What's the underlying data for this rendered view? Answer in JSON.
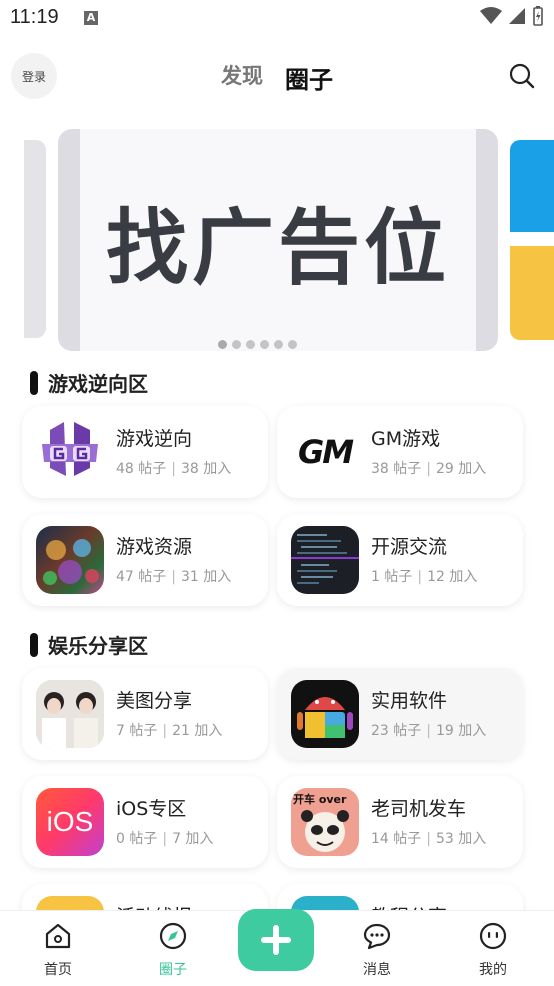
{
  "status_bar": {
    "time": "11:19",
    "notif_letter": "A"
  },
  "header": {
    "login_label": "登录",
    "tabs": [
      {
        "label": "发现",
        "active": false
      },
      {
        "label": "圈子",
        "active": true
      }
    ]
  },
  "banner": {
    "text": "找广告位",
    "dot_count": 6,
    "active_dot": 0
  },
  "sections": [
    {
      "title": "游戏逆向区",
      "cards": [
        {
          "title": "游戏逆向",
          "posts": "48 帖子",
          "joins": "38 加入",
          "icon": "game-guardian-icon"
        },
        {
          "title": "GM游戏",
          "posts": "38 帖子",
          "joins": "29 加入",
          "icon": "gm-logo-icon",
          "icon_text": "GM"
        },
        {
          "title": "游戏资源",
          "posts": "47 帖子",
          "joins": "31 加入",
          "icon": "game-art-icon"
        },
        {
          "title": "开源交流",
          "posts": "1 帖子",
          "joins": "12 加入",
          "icon": "code-terminal-icon"
        }
      ]
    },
    {
      "title": "娱乐分享区",
      "cards": [
        {
          "title": "美图分享",
          "posts": "7 帖子",
          "joins": "21 加入",
          "icon": "photo-girls-icon"
        },
        {
          "title": "实用软件",
          "posts": "23 帖子",
          "joins": "19 加入",
          "icon": "android-logo-icon"
        },
        {
          "title": "iOS专区",
          "posts": "0 帖子",
          "joins": "7 加入",
          "icon": "ios-logo-icon",
          "icon_text": "iOS"
        },
        {
          "title": "老司机发车",
          "posts": "14 帖子",
          "joins": "53 加入",
          "icon": "panda-meme-icon",
          "icon_text": "开车 over"
        },
        {
          "title": "活动线报",
          "icon": "partial-card-icon"
        },
        {
          "title": "教程分享",
          "icon": "partial-card-icon"
        }
      ]
    }
  ],
  "nav": {
    "items": [
      {
        "label": "首页",
        "icon": "home-icon",
        "active": false
      },
      {
        "label": "圈子",
        "icon": "compass-icon",
        "active": true
      },
      {
        "label": "消息",
        "icon": "chat-icon",
        "active": false
      },
      {
        "label": "我的",
        "icon": "profile-face-icon",
        "active": false
      }
    ]
  },
  "colors": {
    "accent": "#3ecba0",
    "accent_text": "#36c49a",
    "banner_text": "#3a3c44"
  }
}
